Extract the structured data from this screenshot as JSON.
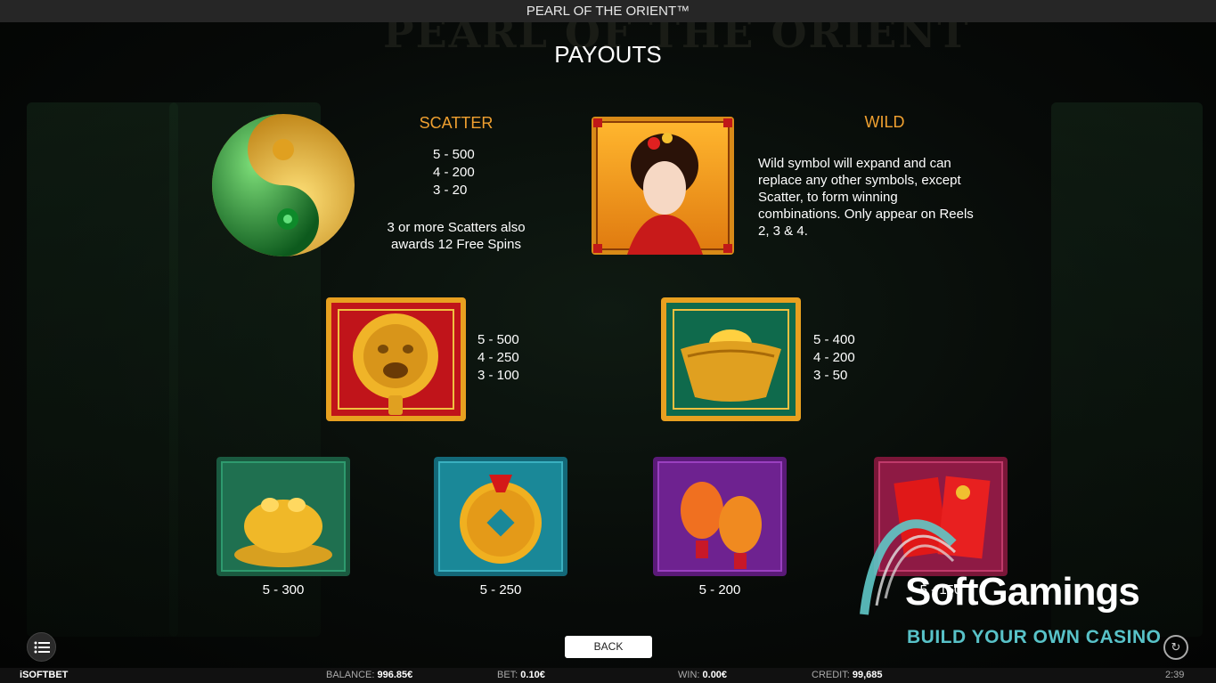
{
  "window_title": "PEARL OF THE ORIENT™",
  "background_title": "PEARL OF THE ORIENT",
  "page_title": "PAYOUTS",
  "scatter": {
    "label": "SCATTER",
    "pays": [
      "5 - 500",
      "4 - 200",
      "3 - 20"
    ],
    "note_line1": "3 or more Scatters also",
    "note_line2": "awards 12 Free Spins"
  },
  "wild": {
    "label": "WILD",
    "desc_lines": [
      "Wild symbol will expand and can",
      "replace any other symbols, except",
      "Scatter, to form winning",
      "combinations. Only appear on Reels",
      "2, 3 & 4."
    ]
  },
  "lion": {
    "pays": [
      "5 - 500",
      "4 - 250",
      "3 - 100"
    ]
  },
  "ingot": {
    "pays": [
      "5 - 400",
      "4 - 200",
      "3 - 50"
    ]
  },
  "low_symbols": [
    {
      "name": "toad",
      "pay": "5 - 300"
    },
    {
      "name": "coin",
      "pay": "5 - 250"
    },
    {
      "name": "lanterns",
      "pay": "5 - 200"
    },
    {
      "name": "envelopes",
      "pay": "5 - 150"
    }
  ],
  "back_label": "BACK",
  "bottom_bar": {
    "brand_i": "i",
    "brand": "SOFTBET",
    "balance_label": "BALANCE:",
    "balance_value": "996.85€",
    "bet_label": "BET:",
    "bet_value": "0.10€",
    "win_label": "WIN:",
    "win_value": "0.00€",
    "credit_label": "CREDIT:",
    "credit_value": "99,685",
    "clock": "2:39"
  },
  "watermark": {
    "name": "SoftGamings",
    "tagline": "BUILD YOUR OWN CASINO"
  },
  "colors": {
    "accent_orange": "#f0a030",
    "teal": "#58c2c8",
    "topbar": "#262626"
  }
}
